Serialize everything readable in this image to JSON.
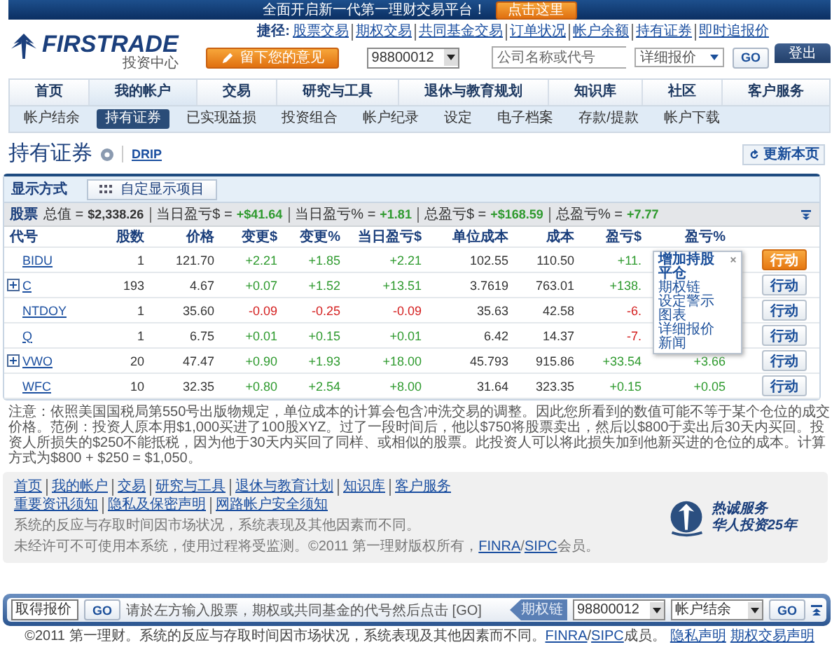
{
  "banner": {
    "text": "全面开启新一代第一理财交易平台！",
    "button": "点击这里"
  },
  "logo": {
    "name": "FIRSTRADE",
    "subtitle": "投资中心"
  },
  "shortcuts": {
    "label": "捷径:",
    "links": [
      "股票交易",
      "期权交易",
      "共同基金交易",
      "订单状况",
      "帐户余额",
      "持有证券",
      "即时追报价"
    ]
  },
  "logout": "登出",
  "feedback_button": "留下您的意见",
  "account_select": "98800012",
  "quote_search": {
    "placeholder": "公司名称或代号",
    "type": "详细报价",
    "button": "GO"
  },
  "main_nav": [
    {
      "label": "首页",
      "selected": false
    },
    {
      "label": "我的帐户",
      "selected": true
    },
    {
      "label": "交易",
      "selected": false
    },
    {
      "label": "研究与工具",
      "selected": false
    },
    {
      "label": "退休与教育规划",
      "selected": false
    },
    {
      "label": "知识库",
      "selected": false
    },
    {
      "label": "社区",
      "selected": false
    },
    {
      "label": "客户服务",
      "selected": false
    }
  ],
  "sub_nav": [
    {
      "label": "帐户结余",
      "selected": false
    },
    {
      "label": "持有证券",
      "selected": true
    },
    {
      "label": "已实现益损",
      "selected": false
    },
    {
      "label": "投资组合",
      "selected": false
    },
    {
      "label": "帐户纪录",
      "selected": false
    },
    {
      "label": "设定",
      "selected": false
    },
    {
      "label": "电子档案",
      "selected": false
    },
    {
      "label": "存款/提款",
      "selected": false
    },
    {
      "label": "帐户下载",
      "selected": false
    }
  ],
  "page": {
    "title": "持有证券",
    "link": "DRIP",
    "refresh": "更新本页"
  },
  "toolbar": {
    "label": "显示方式",
    "button": "自定显示项目"
  },
  "summary": {
    "label": "股票",
    "items": [
      {
        "label": "总值 =",
        "value": "$2,338.26"
      },
      {
        "label": "当日盈亏$ =",
        "value": "+$41.64",
        "color": "#2e9a2e"
      },
      {
        "label": "当日盈亏% =",
        "value": "+1.81",
        "color": "#2e9a2e"
      },
      {
        "label": "总盈亏$ =",
        "value": "+$168.59",
        "color": "#2e9a2e"
      },
      {
        "label": "总盈亏% =",
        "value": "+7.77",
        "color": "#2e9a2e"
      }
    ]
  },
  "table": {
    "columns": [
      "代号",
      "股数",
      "价格",
      "变更$",
      "变更%",
      "当日盈亏$",
      "单位成本",
      "成本",
      "盈亏$",
      "盈亏%"
    ],
    "rows": [
      {
        "cells": [
          {
            "text": "BIDU",
            "kind": "symbol",
            "expandable": false
          },
          {
            "text": "1"
          },
          {
            "text": "121.70"
          },
          {
            "text": "+2.21",
            "color": "#2e9a2e"
          },
          {
            "text": "+1.85",
            "color": "#2e9a2e"
          },
          {
            "text": "+2.21",
            "color": "#2e9a2e"
          },
          {
            "text": "102.55"
          },
          {
            "text": "110.50"
          },
          {
            "text": "+11.",
            "color": "#2e9a2e"
          }
        ],
        "action": {
          "label": "行动",
          "highlighted": true
        }
      },
      {
        "cells": [
          {
            "text": "C",
            "kind": "symbol",
            "expandable": true
          },
          {
            "text": "193"
          },
          {
            "text": "4.67"
          },
          {
            "text": "+0.07",
            "color": "#2e9a2e"
          },
          {
            "text": "+1.52",
            "color": "#2e9a2e"
          },
          {
            "text": "+13.51",
            "color": "#2e9a2e"
          },
          {
            "text": "3.7619"
          },
          {
            "text": "763.01"
          },
          {
            "text": "+138.",
            "color": "#2e9a2e"
          }
        ],
        "action": {
          "label": "行动",
          "highlighted": false
        }
      },
      {
        "cells": [
          {
            "text": "NTDOY",
            "kind": "symbol",
            "expandable": false
          },
          {
            "text": "1"
          },
          {
            "text": "35.60"
          },
          {
            "text": "-0.09",
            "color": "#d42020"
          },
          {
            "text": "-0.25",
            "color": "#d42020"
          },
          {
            "text": "-0.09",
            "color": "#d42020"
          },
          {
            "text": "35.63"
          },
          {
            "text": "42.58"
          },
          {
            "text": "-6.",
            "color": "#d42020"
          }
        ],
        "action": {
          "label": "行动",
          "highlighted": false
        }
      },
      {
        "cells": [
          {
            "text": "Q",
            "kind": "symbol",
            "expandable": false
          },
          {
            "text": "1"
          },
          {
            "text": "6.75"
          },
          {
            "text": "+0.01",
            "color": "#2e9a2e"
          },
          {
            "text": "+0.15",
            "color": "#2e9a2e"
          },
          {
            "text": "+0.01",
            "color": "#2e9a2e"
          },
          {
            "text": "6.42"
          },
          {
            "text": "14.37"
          },
          {
            "text": "-7.",
            "color": "#d42020"
          }
        ],
        "action": {
          "label": "行动",
          "highlighted": false
        }
      },
      {
        "cells": [
          {
            "text": "VWO",
            "kind": "symbol",
            "expandable": true
          },
          {
            "text": "20"
          },
          {
            "text": "47.47"
          },
          {
            "text": "+0.90",
            "color": "#2e9a2e"
          },
          {
            "text": "+1.93",
            "color": "#2e9a2e"
          },
          {
            "text": "+18.00",
            "color": "#2e9a2e"
          },
          {
            "text": "45.793"
          },
          {
            "text": "915.86"
          },
          {
            "text": "+33.54",
            "color": "#2e9a2e"
          },
          {
            "text": "+3.66",
            "color": "#2e9a2e"
          }
        ],
        "action": {
          "label": "行动",
          "highlighted": false
        }
      },
      {
        "cells": [
          {
            "text": "WFC",
            "kind": "symbol",
            "expandable": false
          },
          {
            "text": "10"
          },
          {
            "text": "32.35"
          },
          {
            "text": "+0.80",
            "color": "#2e9a2e"
          },
          {
            "text": "+2.54",
            "color": "#2e9a2e"
          },
          {
            "text": "+8.00",
            "color": "#2e9a2e"
          },
          {
            "text": "31.64"
          },
          {
            "text": "323.35"
          },
          {
            "text": "+0.15",
            "color": "#2e9a2e"
          },
          {
            "text": "+0.05",
            "color": "#2e9a2e"
          }
        ],
        "action": {
          "label": "行动",
          "highlighted": false
        }
      }
    ]
  },
  "action_menu": {
    "items": [
      {
        "label": "增加持股",
        "bold": true
      },
      {
        "label": "平仓",
        "bold": true
      },
      {
        "label": "期权链",
        "bold": false
      },
      {
        "label": "设定警示",
        "bold": false
      },
      {
        "label": "图表",
        "bold": false
      },
      {
        "label": "详细报价",
        "bold": false
      },
      {
        "label": "新闻",
        "bold": false
      }
    ]
  },
  "note": "注意：依照美国国税局第550号出版物规定，单位成本的计算会包含冲洗交易的调整。因此您所看到的数值可能不等于某个仓位的成交价格。范例：投资人原本用$1,000买进了100股XYZ。过了一段时间后，他以$750将股票卖出，然后以$800于卖出后30天内买回。投资人所损失的$250不能抵税，因为他于30天内买回了同样、或相似的股票。此投资人可以将此损失加到他新买进的仓位的成本。计算方式为$800 + $250 = $1,050。",
  "footer": {
    "links": [
      "首页",
      "我的帐户",
      "交易",
      "研究与工具",
      "退休与教育计划",
      "知识库",
      "客户服务"
    ],
    "links_2": [
      "重要资讯须知",
      "隐私及保密声明",
      "网路帐户安全须知"
    ],
    "line_1": "系统的反应与存取时间因市场状况，系统表现及其他因素而不同。",
    "line_2": "未经许可不可使用本系统，使用过程将受监测。©2011 第一理财版权所有，",
    "line_2_links": [
      "FINRA",
      "SIPC"
    ],
    "link_separator": "/",
    "line_2_end": "会员。",
    "badge": [
      "热诚服务",
      "华人投资25年"
    ]
  },
  "quote_bar": {
    "value": "取得报价",
    "button": "GO",
    "hint": "请於左方输入股票，期权或共同基金的代号然后点击 [GO]",
    "label": "期权链",
    "account": "98800012",
    "view": "帐户结余",
    "go": "GO"
  },
  "copyright": {
    "text": "©2011 第一理财。系统的反应与存取时间因市场状况，系统表现及其他因素而不同。",
    "links": [
      "FINRA",
      "SIPC"
    ],
    "link_separator": "/",
    "member": "成员。",
    "legal_links": [
      "隐私声明",
      "期权交易声明"
    ]
  }
}
